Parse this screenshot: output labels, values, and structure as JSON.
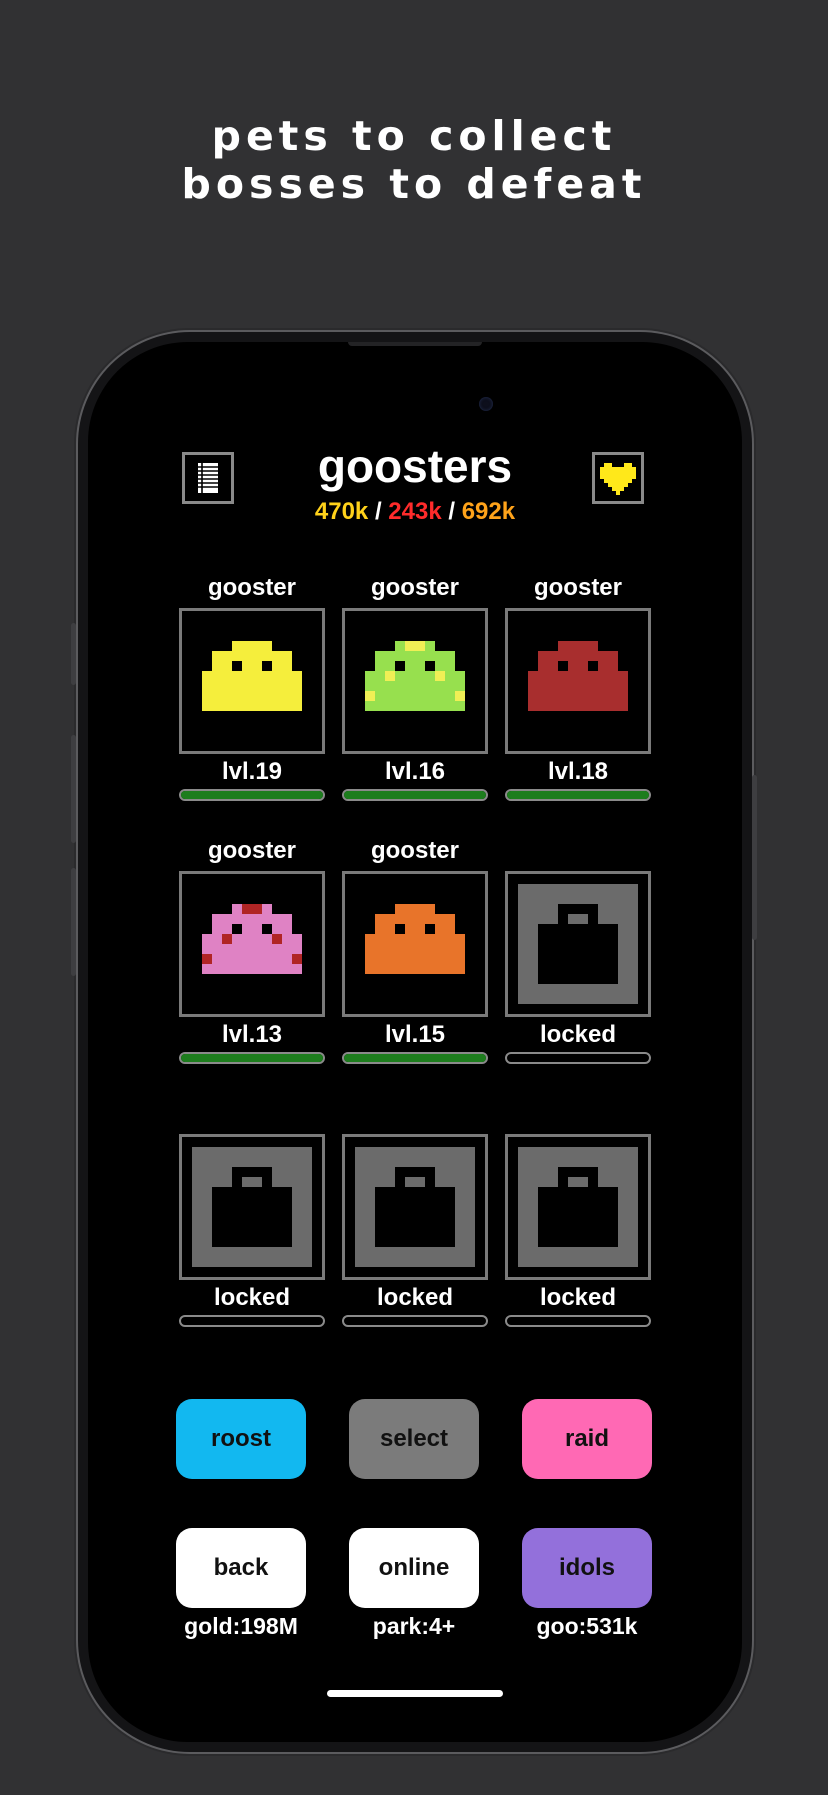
{
  "tagline": [
    "pets to collect",
    "bosses to defeat"
  ],
  "app": {
    "title": "goosters",
    "stats": [
      {
        "value": "470k",
        "color": "#ffd21a"
      },
      {
        "value": "243k",
        "color": "#ff2b2b"
      },
      {
        "value": "692k",
        "color": "#ffa31a"
      }
    ],
    "stats_separator": " / ",
    "menu_icon": "list-icon",
    "favorite_icon": "heart-icon"
  },
  "slots": [
    {
      "name": "gooster",
      "level": "lvl.19",
      "locked": false,
      "body_color": "#f5ee3c",
      "spot_color": "#f5ee3c",
      "progress": 1.0
    },
    {
      "name": "gooster",
      "level": "lvl.16",
      "locked": false,
      "body_color": "#97e04e",
      "spot_color": "#f0ef55",
      "progress": 1.0
    },
    {
      "name": "gooster",
      "level": "lvl.18",
      "locked": false,
      "body_color": "#a82e2e",
      "spot_color": "#a82e2e",
      "progress": 1.0
    },
    {
      "name": "gooster",
      "level": "lvl.13",
      "locked": false,
      "body_color": "#df82c4",
      "spot_color": "#b02525",
      "progress": 1.0
    },
    {
      "name": "gooster",
      "level": "lvl.15",
      "locked": false,
      "body_color": "#e8742a",
      "spot_color": "#e8742a",
      "progress": 1.0
    },
    {
      "name": "",
      "level": "locked",
      "locked": true,
      "progress": 0
    },
    {
      "name": "",
      "level": "locked",
      "locked": true,
      "progress": 0
    },
    {
      "name": "",
      "level": "locked",
      "locked": true,
      "progress": 0
    },
    {
      "name": "",
      "level": "locked",
      "locked": true,
      "progress": 0
    }
  ],
  "actions": [
    {
      "label": "roost",
      "color": "#12b8f0"
    },
    {
      "label": "select",
      "color": "#7b7b7b"
    },
    {
      "label": "raid",
      "color": "#ff69b4"
    },
    {
      "label": "back",
      "color": "#ffffff"
    },
    {
      "label": "online",
      "color": "#ffffff"
    },
    {
      "label": "idols",
      "color": "#9370db"
    }
  ],
  "resources": [
    "gold:198M",
    "park:4+",
    "goo:531k"
  ],
  "colors": {
    "background": "#313133",
    "screen": "#000000",
    "progress_fill": "#1d7d1d",
    "locked_gray": "#6b6b6b"
  }
}
